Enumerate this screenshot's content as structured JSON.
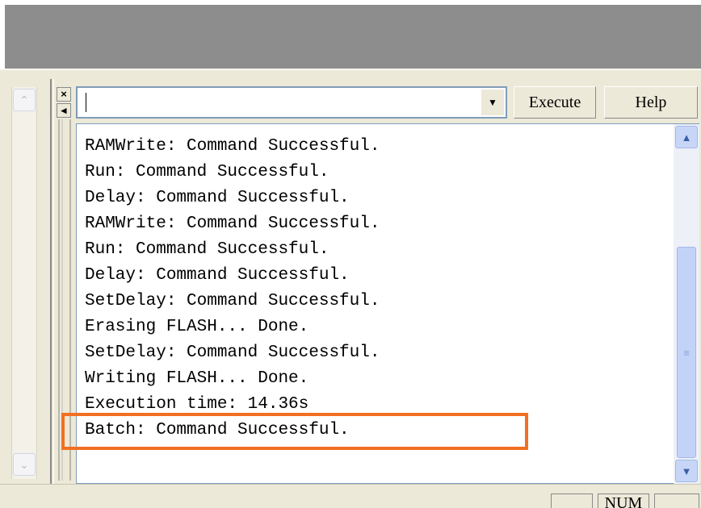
{
  "toolbar": {
    "command_value": "",
    "execute_label": "Execute",
    "help_label": "Help",
    "close_glyph": "×",
    "arrow_glyph": "◂"
  },
  "output": {
    "lines": [
      "RAMWrite: Command Successful.",
      "Run: Command Successful.",
      "Delay: Command Successful.",
      "RAMWrite: Command Successful.",
      "Run: Command Successful.",
      "Delay: Command Successful.",
      "SetDelay: Command Successful.",
      "Erasing FLASH... Done.",
      "SetDelay: Command Successful.",
      "Writing FLASH... Done.",
      "Execution time: 14.36s",
      "Batch: Command Successful."
    ],
    "highlighted_line_index": 11
  },
  "statusbar": {
    "num_label": "NUM"
  },
  "colors": {
    "highlight": "#f26f21",
    "chrome": "#ece9d8",
    "titlebar": "#8d8d8d"
  },
  "icons": {
    "dropdown": "chevron-down-icon",
    "scroll_up": "chevron-up-icon",
    "scroll_down": "chevron-down-icon",
    "close": "close-icon"
  }
}
